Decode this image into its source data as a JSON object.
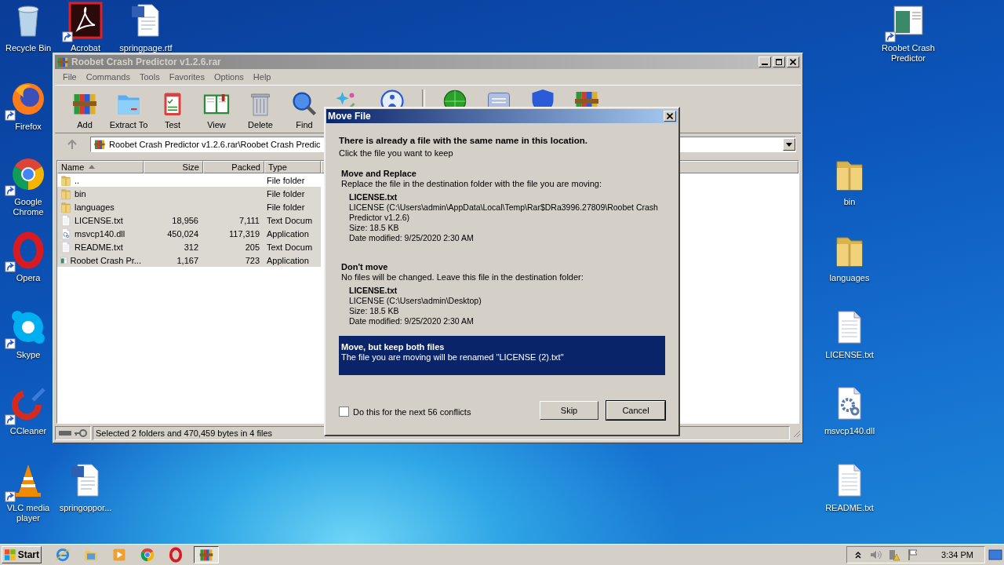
{
  "desktop": {
    "icons": [
      {
        "label": "Recycle Bin",
        "kind": "recycle",
        "shortcut": false
      },
      {
        "label": "Acrobat",
        "kind": "redlogo",
        "shortcut": true
      },
      {
        "label": "springpage.rtf",
        "kind": "worddoc",
        "shortcut": false
      },
      {
        "label": "Firefox",
        "kind": "firefox",
        "shortcut": true
      },
      {
        "label": "Google Chrome",
        "kind": "chrome",
        "shortcut": true
      },
      {
        "label": "Opera",
        "kind": "opera",
        "shortcut": true
      },
      {
        "label": "Skype",
        "kind": "skype",
        "shortcut": true
      },
      {
        "label": "CCleaner",
        "kind": "ccleaner",
        "shortcut": true
      },
      {
        "label": "VLC media player",
        "kind": "vlc",
        "shortcut": true
      },
      {
        "label": "springoppor...",
        "kind": "worddoc",
        "shortcut": false
      },
      {
        "label": "Roobet Crash Predictor",
        "kind": "appwindow",
        "shortcut": true
      },
      {
        "label": "bin",
        "kind": "folder",
        "shortcut": false
      },
      {
        "label": "languages",
        "kind": "folder",
        "shortcut": false
      },
      {
        "label": "LICENSE.txt",
        "kind": "textfile",
        "shortcut": false
      },
      {
        "label": "msvcp140.dll",
        "kind": "gearfile",
        "shortcut": false
      },
      {
        "label": "README.txt",
        "kind": "textfile",
        "shortcut": false
      }
    ]
  },
  "window": {
    "title": "Roobet Crash Predictor v1.2.6.rar",
    "active": false,
    "menu": [
      "File",
      "Commands",
      "Tools",
      "Favorites",
      "Options",
      "Help"
    ],
    "toolbar": {
      "groups": [
        [
          {
            "label": "Add",
            "kind": "books"
          },
          {
            "label": "Extract To",
            "kind": "extract"
          },
          {
            "label": "Test",
            "kind": "clipboard"
          },
          {
            "label": "View",
            "kind": "openbook"
          },
          {
            "label": "Delete",
            "kind": "trash"
          },
          {
            "label": "Find",
            "kind": "magnifier"
          },
          {
            "kind": "sparkle"
          },
          {
            "kind": "profile"
          }
        ],
        [
          {
            "kind": "radar"
          },
          {
            "kind": "note"
          },
          {
            "kind": "shield"
          },
          {
            "kind": "books"
          }
        ]
      ]
    },
    "address": {
      "path": "Roobet Crash Predictor v1.2.6.rar\\Roobet Crash Predic"
    },
    "list": {
      "columns": [
        {
          "label": "Name",
          "sorted": true
        },
        {
          "label": "Size",
          "sorted": false
        },
        {
          "label": "Packed",
          "sorted": false
        },
        {
          "label": "Type",
          "sorted": false
        }
      ],
      "rows": [
        {
          "name": "..",
          "size": "",
          "packed": "",
          "type": "File folder",
          "kind": "folder",
          "selected": false
        },
        {
          "name": "bin",
          "size": "",
          "packed": "",
          "type": "File folder",
          "kind": "folder",
          "selected": true
        },
        {
          "name": "languages",
          "size": "",
          "packed": "",
          "type": "File folder",
          "kind": "folder",
          "selected": true
        },
        {
          "name": "LICENSE.txt",
          "size": "18,956",
          "packed": "7,111",
          "type": "Text Docum",
          "kind": "textfile",
          "selected": true
        },
        {
          "name": "msvcp140.dll",
          "size": "450,024",
          "packed": "117,319",
          "type": "Application",
          "kind": "gearfile",
          "selected": true
        },
        {
          "name": "README.txt",
          "size": "312",
          "packed": "205",
          "type": "Text Docum",
          "kind": "textfile",
          "selected": true
        },
        {
          "name": "Roobet Crash Pr...",
          "size": "1,167",
          "packed": "723",
          "type": "Application",
          "kind": "appwindow",
          "selected": true
        }
      ]
    },
    "status_bar": {
      "text": "Selected 2 folders and 470,459 bytes in 4 files"
    }
  },
  "dialog": {
    "title": "Move File",
    "heading": "There is already a file with the same name in this location.",
    "subheading": "Click the file you want to keep",
    "options": [
      {
        "title": "Move and Replace",
        "description": "Replace the file in the destination folder with the file you are moving:",
        "file": {
          "name": "LICENSE.txt",
          "lines": [
            "LICENSE (C:\\Users\\admin\\AppData\\Local\\Temp\\Rar$DRa3996.27809\\Roobet Crash Predictor v1.2.6)",
            "Size: 18.5 KB",
            "Date modified: 9/25/2020 2:30 AM"
          ]
        },
        "selected": false
      },
      {
        "title": "Don't move",
        "description": "No files will be changed. Leave this file in the destination folder:",
        "file": {
          "name": "LICENSE.txt",
          "lines": [
            "LICENSE (C:\\Users\\admin\\Desktop)",
            "Size: 18.5 KB",
            "Date modified: 9/25/2020 2:30 AM"
          ]
        },
        "selected": false
      },
      {
        "title": "Move, but keep both files",
        "description": "The file you are moving will be renamed \"LICENSE (2).txt\"",
        "selected": true
      }
    ],
    "checkbox": {
      "label": "Do this for the next 56 conflicts",
      "checked": false
    },
    "buttons": [
      {
        "label": "Skip",
        "default": false
      },
      {
        "label": "Cancel",
        "default": true
      }
    ]
  },
  "taskbar": {
    "start": "Start",
    "apps": [
      {
        "kind": "ie",
        "active": false
      },
      {
        "kind": "explorer",
        "active": false
      },
      {
        "kind": "media",
        "active": false
      },
      {
        "kind": "chrome",
        "active": false
      },
      {
        "kind": "opera",
        "active": false
      },
      {
        "kind": "books",
        "active": true
      }
    ],
    "clock": "3:34 PM"
  }
}
